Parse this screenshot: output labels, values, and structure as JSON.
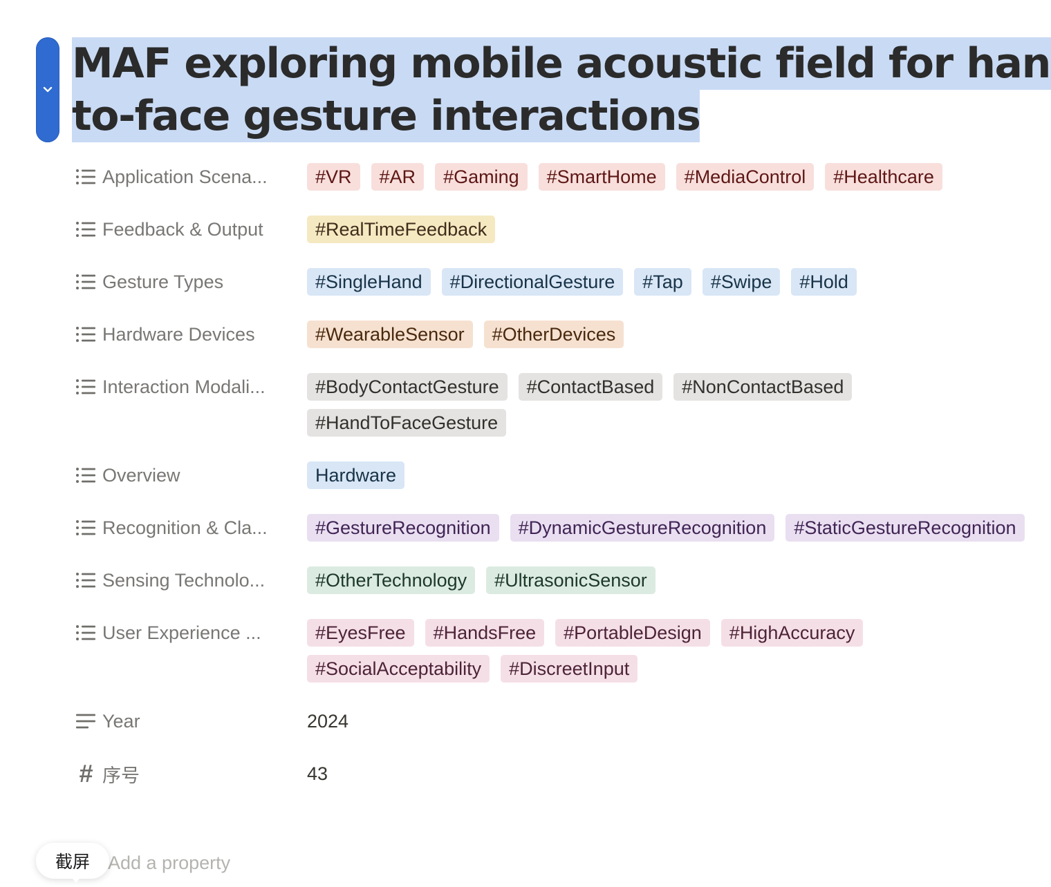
{
  "page": {
    "title_line1": "MAF exploring mobile acoustic field for hand-",
    "title_line2": "to-face gesture interactions"
  },
  "properties": [
    {
      "name": "Application Scena...",
      "icon": "list-icon",
      "tags": [
        {
          "label": "#VR",
          "color": "red"
        },
        {
          "label": "#AR",
          "color": "red"
        },
        {
          "label": "#Gaming",
          "color": "red"
        },
        {
          "label": "#SmartHome",
          "color": "red"
        },
        {
          "label": "#MediaControl",
          "color": "red"
        },
        {
          "label": "#Healthcare",
          "color": "red"
        }
      ]
    },
    {
      "name": "Feedback & Output",
      "icon": "list-icon",
      "tags": [
        {
          "label": "#RealTimeFeedback",
          "color": "yellow"
        }
      ]
    },
    {
      "name": "Gesture Types",
      "icon": "list-icon",
      "tags": [
        {
          "label": "#SingleHand",
          "color": "blue"
        },
        {
          "label": "#DirectionalGesture",
          "color": "blue"
        },
        {
          "label": "#Tap",
          "color": "blue"
        },
        {
          "label": "#Swipe",
          "color": "blue"
        },
        {
          "label": "#Hold",
          "color": "blue"
        }
      ]
    },
    {
      "name": "Hardware Devices",
      "icon": "list-icon",
      "tags": [
        {
          "label": "#WearableSensor",
          "color": "orange"
        },
        {
          "label": "#OtherDevices",
          "color": "orange"
        }
      ]
    },
    {
      "name": "Interaction Modali...",
      "icon": "list-icon",
      "tags": [
        {
          "label": "#BodyContactGesture",
          "color": "gray"
        },
        {
          "label": "#ContactBased",
          "color": "gray"
        },
        {
          "label": "#NonContactBased",
          "color": "gray"
        },
        {
          "label": "#HandToFaceGesture",
          "color": "gray"
        }
      ]
    },
    {
      "name": "Overview",
      "icon": "list-icon",
      "tags": [
        {
          "label": "Hardware",
          "color": "blue"
        }
      ]
    },
    {
      "name": "Recognition & Cla...",
      "icon": "list-icon",
      "tags": [
        {
          "label": "#GestureRecognition",
          "color": "purple"
        },
        {
          "label": "#DynamicGestureRecognition",
          "color": "purple"
        },
        {
          "label": "#StaticGestureRecognition",
          "color": "purple"
        }
      ]
    },
    {
      "name": "Sensing Technolo...",
      "icon": "list-icon",
      "tags": [
        {
          "label": "#OtherTechnology",
          "color": "green"
        },
        {
          "label": "#UltrasonicSensor",
          "color": "green"
        }
      ]
    },
    {
      "name": "User Experience ...",
      "icon": "list-icon",
      "tags": [
        {
          "label": "#EyesFree",
          "color": "pink"
        },
        {
          "label": "#HandsFree",
          "color": "pink"
        },
        {
          "label": "#PortableDesign",
          "color": "pink"
        },
        {
          "label": "#HighAccuracy",
          "color": "pink"
        },
        {
          "label": "#SocialAcceptability",
          "color": "pink"
        },
        {
          "label": "#DiscreetInput",
          "color": "pink"
        }
      ]
    },
    {
      "name": "Year",
      "icon": "text-lines-icon",
      "value": "2024"
    },
    {
      "name": "序号",
      "icon": "hash-icon",
      "value": "43"
    }
  ],
  "add_property_label": "Add a property",
  "tooltip": {
    "label": "截屏"
  },
  "colors": {
    "accent": "#2f6bd0",
    "title_highlight": "#c9daf4"
  }
}
